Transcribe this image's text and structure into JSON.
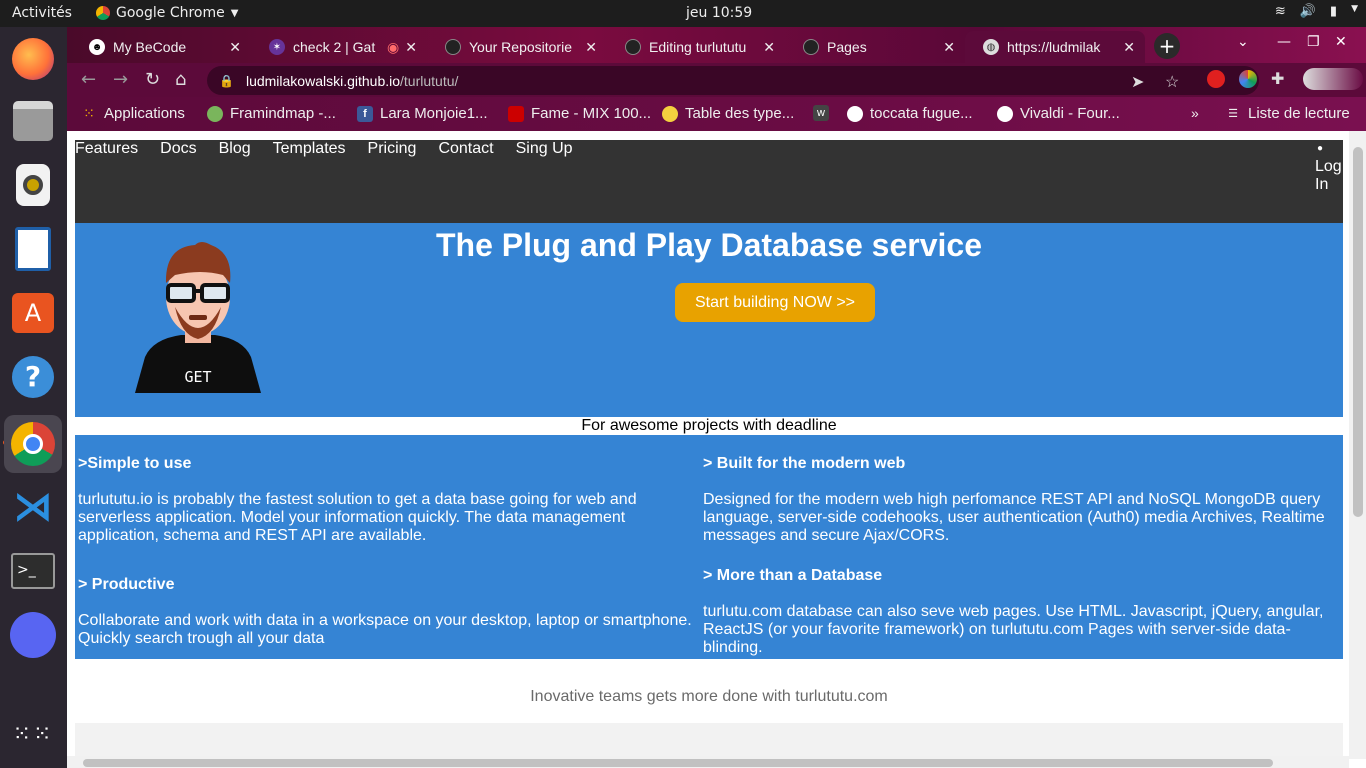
{
  "os": {
    "activities": "Activités",
    "app_name": "Google Chrome",
    "clock": "jeu 10:59"
  },
  "tabs": [
    {
      "label": "My BeCode"
    },
    {
      "label": "check 2 | Gat"
    },
    {
      "label": "Your Repositorie"
    },
    {
      "label": "Editing turlututu"
    },
    {
      "label": "Pages"
    },
    {
      "label": "https://ludmilak"
    }
  ],
  "address": {
    "host": "ludmilakowalski.github.io",
    "path": "/turlututu/"
  },
  "bookmarks": [
    {
      "label": "Applications"
    },
    {
      "label": "Framindmap -..."
    },
    {
      "label": "Lara Monjoie1..."
    },
    {
      "label": "Fame - MIX 100..."
    },
    {
      "label": "Table des type..."
    },
    {
      "label": "toccata fugue..."
    },
    {
      "label": "Vivaldi - Four..."
    },
    {
      "label": "Liste de lecture"
    }
  ],
  "site": {
    "nav": [
      "Features",
      "Docs",
      "Blog",
      "Templates",
      "Pricing",
      "Contact",
      "Sing Up"
    ],
    "login_line1": "Log",
    "login_line2": "In",
    "hero_title": "The Plug and Play Database service",
    "cta_label": "Start building NOW >>",
    "avatar_label": "GET",
    "tagline": "For awesome projects with deadline",
    "features": {
      "f1_title": ">Simple to use",
      "f1_text": "turlututu.io is probably the fastest solution to get a data base going for web and serverless application. Model your information quickly. The data management application, schema and REST API are available.",
      "f2_title": "> Productive",
      "f2_text": "Collaborate and work with data in a workspace on your desktop, laptop or smartphone. Quickly search trough all your data",
      "f3_title": "> Built for the modern web",
      "f3_text": "Designed for the modern web high perfomance REST API and NoSQL MongoDB query language, server-side codehooks, user authentication (Auth0) media Archives, Realtime messages and secure Ajax/CORS.",
      "f4_title": "> More than a Database",
      "f4_text": "turlutu.com database can also seve web pages. Use HTML. Javascript, jQuery, angular, ReactJS (or your favorite framework) on turlututu.com Pages with server-side data-blinding."
    },
    "footer_line": "Inovative teams gets more done with turlututu.com"
  },
  "colors": {
    "hero_blue": "#3584d4",
    "cta_orange": "#e8a200",
    "nav_dark": "#333333",
    "chrome_theme": "#5c0a3a"
  }
}
